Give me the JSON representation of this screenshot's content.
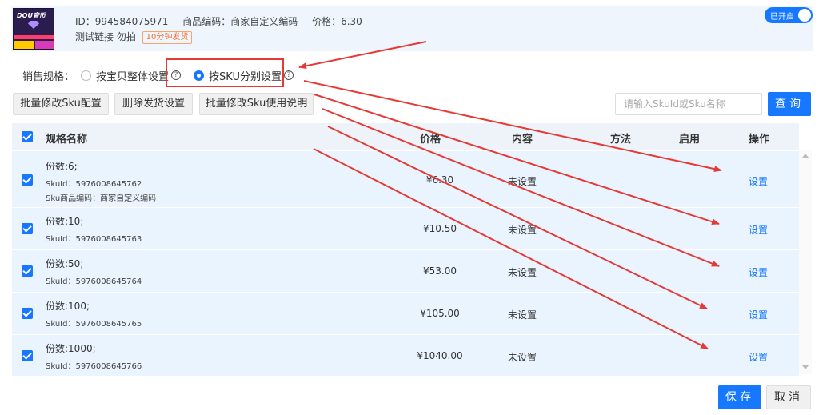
{
  "product": {
    "thumb_text": "DOU音币",
    "id": "ID：994584075971",
    "code": "商品编码：商家自定义编码",
    "price": "价格：6.30",
    "name": "测试链接 勿拍",
    "tag": "10分钟发货",
    "toggle_label": "已开启"
  },
  "spec": {
    "label": "销售规格：",
    "option_whole": "按宝贝整体设置",
    "option_sku": "按SKU分别设置",
    "selected": "option_sku"
  },
  "actions": {
    "batch_edit": "批量修改Sku配置",
    "delete_ship": "删除发货设置",
    "batch_help": "批量修改Sku使用说明",
    "search_placeholder": "请输入SkuId或Sku名称",
    "search_btn": "查询"
  },
  "table": {
    "headers": {
      "name": "规格名称",
      "price": "价格",
      "content": "内容",
      "method": "方法",
      "enabled": "启用",
      "op": "操作"
    },
    "rows": [
      {
        "name": "份数:6;",
        "skuid": "SkuId：5976008645762",
        "skucode": "Sku商品编码：商家自定义编码",
        "price": "¥6.30",
        "content": "未设置",
        "op": "设置"
      },
      {
        "name": "份数:10;",
        "skuid": "SkuId：5976008645763",
        "price": "¥10.50",
        "content": "未设置",
        "op": "设置"
      },
      {
        "name": "份数:50;",
        "skuid": "SkuId：5976008645764",
        "price": "¥53.00",
        "content": "未设置",
        "op": "设置"
      },
      {
        "name": "份数:100;",
        "skuid": "SkuId：5976008645765",
        "price": "¥105.00",
        "content": "未设置",
        "op": "设置"
      },
      {
        "name": "份数:1000;",
        "skuid": "SkuId：5976008645766",
        "price": "¥1040.00",
        "content": "未设置",
        "op": "设置"
      }
    ]
  },
  "footer": {
    "save": "保存",
    "cancel": "取消"
  },
  "colors": {
    "primary": "#1677ff",
    "row_bg": "#eaf4fe",
    "annotation": "#e53935",
    "tag": "#f5702a"
  }
}
